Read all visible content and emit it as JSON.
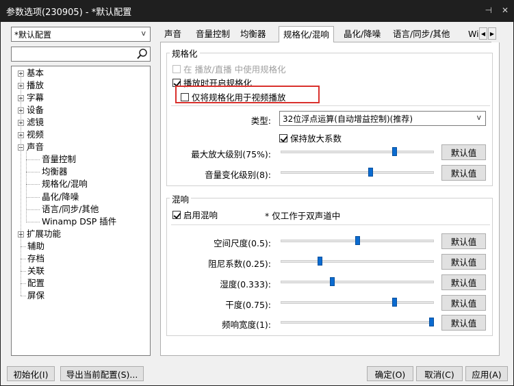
{
  "window": {
    "title": "参数选项(230905) - *默认配置",
    "pin_glyph": "⊣",
    "close_glyph": "✕"
  },
  "profile_select": {
    "value": "*默认配置",
    "arrow": "v"
  },
  "search": {
    "placeholder": ""
  },
  "tree": [
    {
      "label": "基本",
      "expander": "plus"
    },
    {
      "label": "播放",
      "expander": "plus"
    },
    {
      "label": "字幕",
      "expander": "plus"
    },
    {
      "label": "设备",
      "expander": "plus"
    },
    {
      "label": "滤镜",
      "expander": "plus"
    },
    {
      "label": "视频",
      "expander": "plus"
    },
    {
      "label": "声音",
      "expander": "minus"
    },
    {
      "label": "音量控制",
      "child": true
    },
    {
      "label": "均衡器",
      "child": true
    },
    {
      "label": "规格化/混响",
      "child": true,
      "selected": true
    },
    {
      "label": "晶化/降噪",
      "child": true
    },
    {
      "label": "语言/同步/其他",
      "child": true
    },
    {
      "label": "Winamp DSP 插件",
      "child": true
    },
    {
      "label": "扩展功能",
      "expander": "plus"
    },
    {
      "label": "辅助"
    },
    {
      "label": "存档"
    },
    {
      "label": "关联"
    },
    {
      "label": "配置"
    },
    {
      "label": "屏保"
    }
  ],
  "tabs": [
    "声音",
    "音量控制",
    "均衡器",
    "规格化/混响",
    "晶化/降噪",
    "语言/同步/其他",
    "Wi"
  ],
  "active_tab": "规格化/混响",
  "tab_scroll": {
    "left": "◀",
    "right": "▶"
  },
  "normalize": {
    "title": "规格化",
    "use_in_streaming": {
      "label": "在 播放/直播 中使用规格化",
      "checked": false,
      "disabled": true
    },
    "enable_on_play": {
      "label": "播放时开启规格化",
      "checked": true
    },
    "video_only": {
      "label": "仅将规格化用于视频播放",
      "checked": false
    },
    "type_label": "类型:",
    "type_value": "32位浮点运算(自动增益控制)(推荐)",
    "type_arrow": "v",
    "keep_gain": {
      "label": "保持放大系数",
      "checked": true
    },
    "sliders": [
      {
        "label": "最大放大级别(75%):",
        "value": 0.75,
        "button": "默认值"
      },
      {
        "label": "音量变化级别(8):",
        "value": 0.59,
        "button": "默认值"
      }
    ]
  },
  "reverb": {
    "title": "混响",
    "enable": {
      "label": "启用混响",
      "checked": true
    },
    "note": "* 仅工作于双声道中",
    "sliders": [
      {
        "label": "空间尺度(0.5):",
        "value": 0.5,
        "button": "默认值"
      },
      {
        "label": "阻尼系数(0.25):",
        "value": 0.25,
        "button": "默认值"
      },
      {
        "label": "湿度(0.333):",
        "value": 0.33,
        "button": "默认值"
      },
      {
        "label": "干度(0.75):",
        "value": 0.75,
        "button": "默认值"
      },
      {
        "label": "频响宽度(1):",
        "value": 1.0,
        "button": "默认值"
      }
    ]
  },
  "footer": {
    "reset": "初始化(I)",
    "export": "导出当前配置(S)...",
    "ok": "确定(O)",
    "cancel": "取消(C)",
    "apply": "应用(A)"
  },
  "colors": {
    "titlebar": "#1f1f1f",
    "slider_thumb": "#0b6bd0",
    "highlight": "#d9302c"
  }
}
